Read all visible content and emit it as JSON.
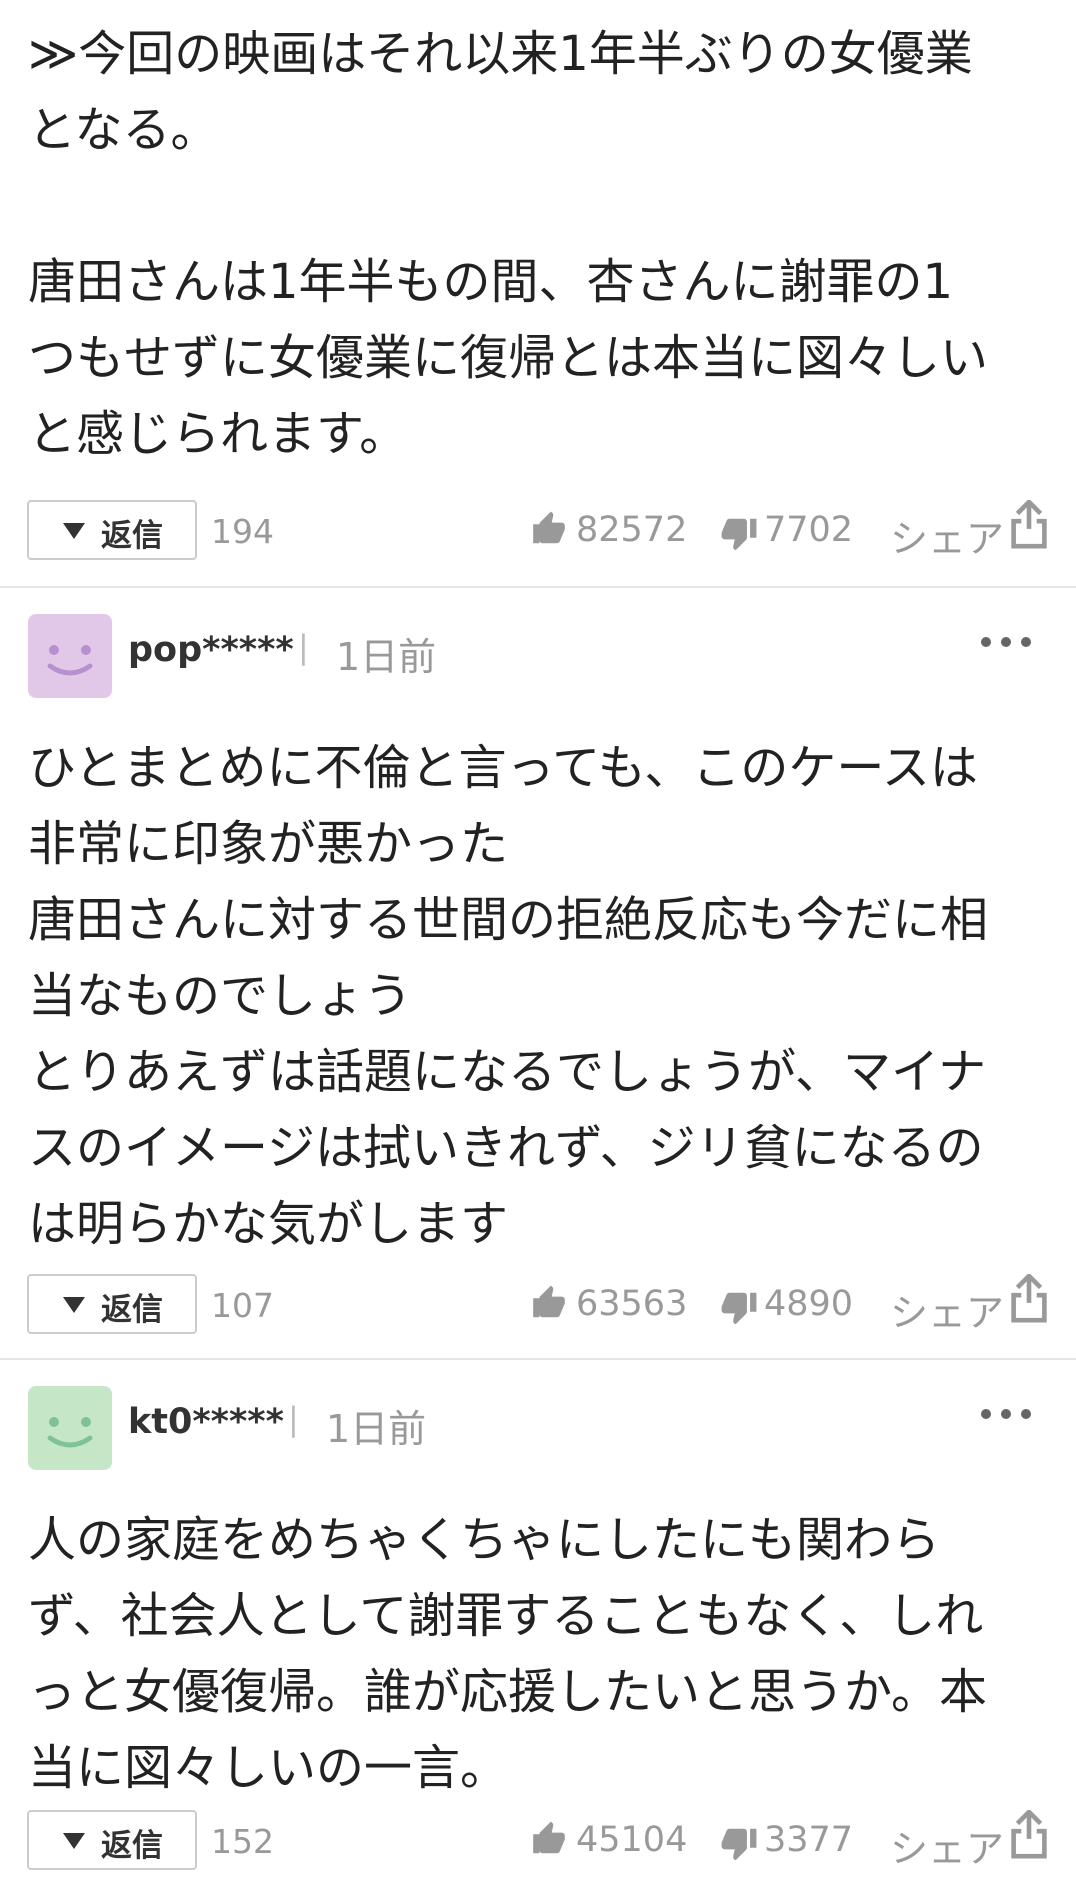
{
  "comments": [
    {
      "text": "≫今回の映画はそれ以来1年半ぶりの女優業\nとなる。\n\n唐田さんは1年半もの間、杏さんに謝罪の1\nつもせずに女優業に復帰とは本当に図々しい\nと感じられます。",
      "reply_label": "返信",
      "reply_count": "194",
      "likes": "82572",
      "dislikes": "7702",
      "share_label": "シェア"
    },
    {
      "username": "pop*****",
      "separator": "|",
      "time": "1日前",
      "avatar_color": "#e2c8e8",
      "avatar_face_color": "#b88fcf",
      "text": "ひとまとめに不倫と言っても、このケースは\n非常に印象が悪かった\n唐田さんに対する世間の拒絶反応も今だに相\n当なものでしょう\nとりあえずは話題になるでしょうが、マイナ\nスのイメージは拭いきれず、ジリ貧になるの\nは明らかな気がします",
      "reply_label": "返信",
      "reply_count": "107",
      "likes": "63563",
      "dislikes": "4890",
      "share_label": "シェア"
    },
    {
      "username": "kt0*****",
      "separator": "|",
      "time": "1日前",
      "avatar_color": "#c6e6c8",
      "avatar_face_color": "#7fc29a",
      "text": "人の家庭をめちゃくちゃにしたにも関わら\nず、社会人として謝罪することもなく、しれ\nっと女優復帰。誰が応援したいと思うか。本\n当に図々しいの一言。",
      "reply_label": "返信",
      "reply_count": "152",
      "likes": "45104",
      "dislikes": "3377",
      "share_label": "シェア"
    }
  ],
  "icons": {
    "like": "thumbs-up-icon",
    "dislike": "thumbs-down-icon",
    "share": "share-icon",
    "more": "more-icon",
    "reply_toggle": "triangle-down-icon"
  },
  "colors": {
    "text": "#222222",
    "muted": "#999999",
    "divider": "#e6e6e6",
    "icon": "#999999"
  }
}
